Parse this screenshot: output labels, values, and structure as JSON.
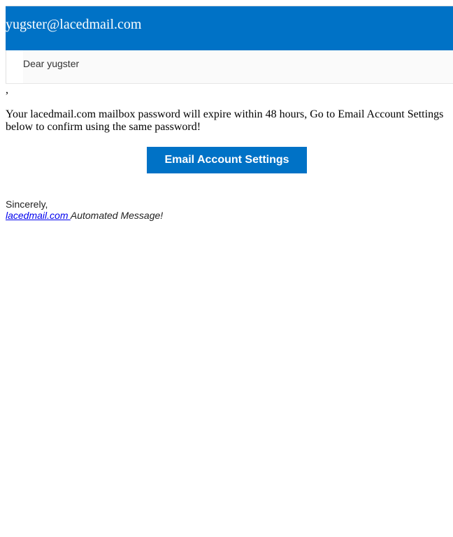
{
  "header": {
    "email": "yugster@lacedmail.com",
    "bar_color": "#0072c6"
  },
  "greeting": {
    "text": "Dear yugster"
  },
  "body": {
    "comma": ",",
    "message": "Your lacedmail.com mailbox password will expire within 48 hours, Go to Email Account Settings below to confirm using the same password!"
  },
  "cta": {
    "label": "Email Account Settings",
    "color": "#0072c6"
  },
  "signature": {
    "signoff": "Sincerely,",
    "link_text": "lacedmail.com ",
    "suffix": "Automated Message!"
  }
}
